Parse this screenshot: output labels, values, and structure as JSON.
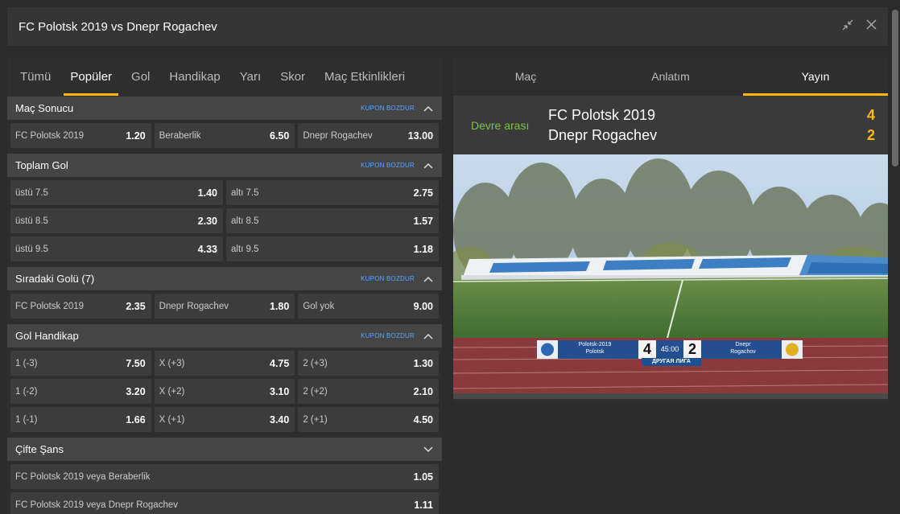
{
  "header": {
    "title": "FC Polotsk 2019 vs Dnepr Rogachev",
    "minimize_icon": "collapse-arrows-icon",
    "close_icon": "close-icon"
  },
  "tabs": [
    {
      "label": "Tümü"
    },
    {
      "label": "Popüler",
      "active": true
    },
    {
      "label": "Gol"
    },
    {
      "label": "Handikap"
    },
    {
      "label": "Yarı"
    },
    {
      "label": "Skor"
    },
    {
      "label": "Maç Etkinlikleri"
    }
  ],
  "kupon_label": "KUPON BOZDUR",
  "sections": {
    "mac_sonucu": {
      "title": "Maç Sonucu",
      "rows": [
        [
          {
            "label": "FC Polotsk 2019",
            "odd": "1.20"
          },
          {
            "label": "Beraberlik",
            "odd": "6.50"
          },
          {
            "label": "Dnepr Rogachev",
            "odd": "13.00"
          }
        ]
      ]
    },
    "toplam_gol": {
      "title": "Toplam Gol",
      "rows": [
        [
          {
            "label": "üstü 7.5",
            "odd": "1.40"
          },
          {
            "label": "altı 7.5",
            "odd": "2.75"
          }
        ],
        [
          {
            "label": "üstü 8.5",
            "odd": "2.30"
          },
          {
            "label": "altı 8.5",
            "odd": "1.57"
          }
        ],
        [
          {
            "label": "üstü 9.5",
            "odd": "4.33"
          },
          {
            "label": "altı 9.5",
            "odd": "1.18"
          }
        ]
      ]
    },
    "siradaki_gol": {
      "title": "Sıradaki Golü (7)",
      "rows": [
        [
          {
            "label": "FC Polotsk 2019",
            "odd": "2.35"
          },
          {
            "label": "Dnepr Rogachev",
            "odd": "1.80"
          },
          {
            "label": "Gol yok",
            "odd": "9.00"
          }
        ]
      ]
    },
    "gol_handikap": {
      "title": "Gol Handikap",
      "rows": [
        [
          {
            "label": "1 (-3)",
            "odd": "7.50"
          },
          {
            "label": "X (+3)",
            "odd": "4.75"
          },
          {
            "label": "2 (+3)",
            "odd": "1.30"
          }
        ],
        [
          {
            "label": "1 (-2)",
            "odd": "3.20"
          },
          {
            "label": "X (+2)",
            "odd": "3.10"
          },
          {
            "label": "2 (+2)",
            "odd": "2.10"
          }
        ],
        [
          {
            "label": "1 (-1)",
            "odd": "1.66"
          },
          {
            "label": "X (+1)",
            "odd": "3.40"
          },
          {
            "label": "2 (+1)",
            "odd": "4.50"
          }
        ]
      ]
    },
    "cifte_sans": {
      "title": "Çifte Şans",
      "rows": [
        [
          {
            "label": "FC Polotsk 2019 veya Beraberlik",
            "odd": "1.05"
          }
        ],
        [
          {
            "label": "FC Polotsk 2019 veya Dnepr Rogachev",
            "odd": "1.11"
          }
        ]
      ]
    }
  },
  "right_tabs": [
    {
      "label": "Maç"
    },
    {
      "label": "Anlatım"
    },
    {
      "label": "Yayın",
      "active": true
    }
  ],
  "scoreboard": {
    "status": "Devre arası",
    "home": {
      "name": "FC Polotsk 2019",
      "score": "4"
    },
    "away": {
      "name": "Dnepr Rogachev",
      "score": "2"
    }
  },
  "video_overlay": {
    "home_name": "Polotsk-2019",
    "home_city": "Polotsk",
    "home_score": "4",
    "time": "45:00",
    "away_score": "2",
    "away_name": "Dnepr",
    "away_city": "Rogachov",
    "league": "ДРУГАЯ ЛИГА"
  },
  "colors": {
    "accent": "#ffb80c",
    "status_green": "#7ec342",
    "link_blue": "#5aa6ff"
  }
}
